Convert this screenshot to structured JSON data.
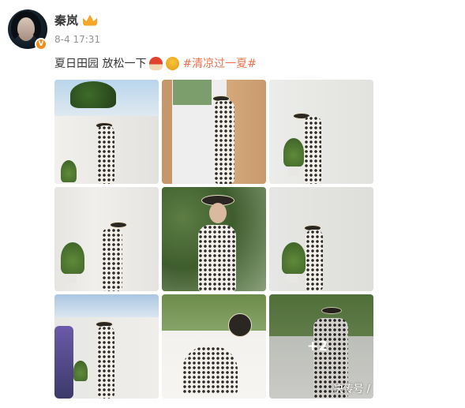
{
  "user": {
    "name": "秦岚",
    "avatar_icon": "avatar-photo",
    "verified_icon": "verified-v-badge",
    "verified_mark": "V",
    "rank_icon": "crown-icon"
  },
  "post": {
    "date": "8-4",
    "time": "17:31",
    "text_part1": "夏日田园 放松一下",
    "emoji1": "mushroom-emoji",
    "emoji2": "wink-emoji",
    "hashtag": "#清凉过一夏#"
  },
  "gallery": {
    "tiles": [
      {
        "alt": "photo-1"
      },
      {
        "alt": "photo-2"
      },
      {
        "alt": "photo-3"
      },
      {
        "alt": "photo-4"
      },
      {
        "alt": "photo-5"
      },
      {
        "alt": "photo-6"
      },
      {
        "alt": "photo-7"
      },
      {
        "alt": "photo-8"
      },
      {
        "alt": "photo-9"
      }
    ],
    "more_count": "+2",
    "watermark": "快传号 /"
  },
  "colors": {
    "text": "#333333",
    "meta": "#939393",
    "hashtag": "#eb7350",
    "verified": "#f08c1a"
  }
}
